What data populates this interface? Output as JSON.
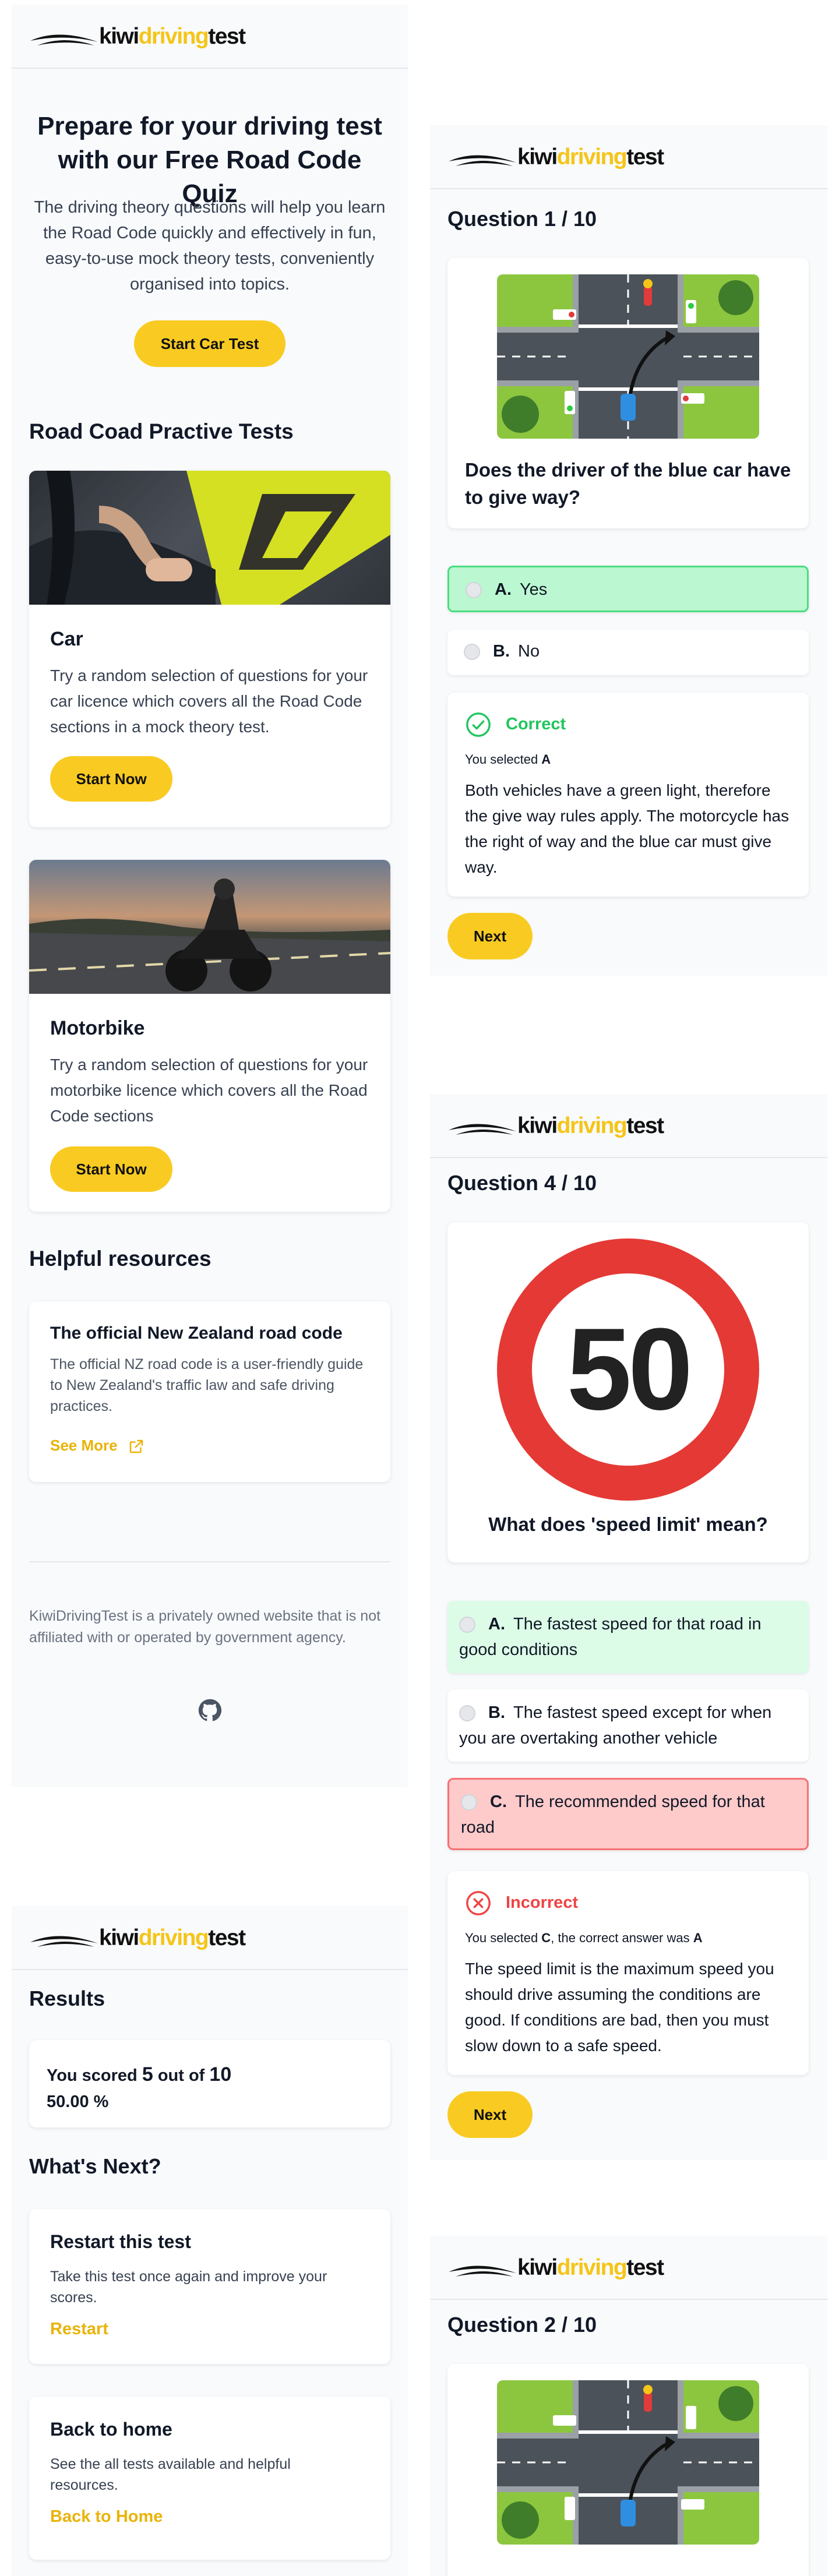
{
  "brand": {
    "kiwi": "kiwi",
    "driving": "driving",
    "test": "test"
  },
  "home": {
    "hero_title": "Prepare for your driving test with our Free Road Code Quiz",
    "hero_text": "The driving theory questions will help you learn the Road Code quickly and effectively in fun, easy-to-use mock theory tests, conveniently organised into topics.",
    "start_car_test": "Start Car Test",
    "section_tests": "Road Coad Practive Tests",
    "car_title": "Car",
    "car_text": "Try a random selection of questions for your car licence which covers all the Road Code sections in a mock theory test.",
    "car_button": "Start Now",
    "moto_title": "Motorbike",
    "moto_text": "Try a random selection of questions for your motorbike licence which covers all the Road Code sections",
    "moto_button": "Start Now",
    "section_resources": "Helpful resources",
    "resource_title": "The official New Zealand road code",
    "resource_text": "The official NZ road code is a user-friendly guide to New Zealand's traffic law and safe driving practices.",
    "resource_link": "See More",
    "footer_text": "KiwiDrivingTest is a privately owned website that is not affiliated with or operated by government agency."
  },
  "quiz1": {
    "counter": "Question 1 / 10",
    "question": "Does the driver of the blue car have to give way?",
    "options": [
      {
        "letter": "A.",
        "text": "Yes"
      },
      {
        "letter": "B.",
        "text": "No"
      }
    ],
    "result": "Correct",
    "selected_prefix": "You selected ",
    "selected": "A",
    "explanation": "Both vehicles have a green light, therefore the give way rules apply. The motorcycle has the right of way and the blue car must give way.",
    "next": "Next"
  },
  "quiz4": {
    "counter": "Question 4 / 10",
    "sign_number": "50",
    "question": "What does 'speed limit' mean?",
    "options": [
      {
        "letter": "A.",
        "text": "The fastest speed for that road in good conditions"
      },
      {
        "letter": "B.",
        "text": "The fastest speed except for when you are overtaking another vehicle"
      },
      {
        "letter": "C.",
        "text": "The recommended speed for that road"
      }
    ],
    "result": "Incorrect",
    "selected_prefix": "You selected ",
    "selected": "C",
    "correct_mid": ", the correct answer was ",
    "correct": "A",
    "explanation": "The speed limit is the maximum speed you should drive assuming the conditions are good. If conditions are bad, then you must slow down to a safe speed.",
    "next": "Next"
  },
  "results": {
    "title": "Results",
    "score_prefix": "You scored ",
    "score": "5",
    "score_mid": " out of ",
    "total": "10",
    "percent": "50.00 %",
    "whats_next": "What's Next?",
    "restart_title": "Restart this test",
    "restart_text": "Take this test once again and improve your scores.",
    "restart_link": "Restart",
    "home_title": "Back to home",
    "home_text": "See the all tests available and helpful resources.",
    "home_link": "Back to Home"
  },
  "quiz2": {
    "counter": "Question 2 / 10"
  },
  "colors": {
    "accent": "#f9cb22",
    "correct_bg": "#bbf7d0",
    "correct_border": "#4ade80",
    "wrong_bg": "#fecaca",
    "wrong_border": "#f87171",
    "good_green": "#22c55e",
    "bad_red": "#ef4444"
  }
}
